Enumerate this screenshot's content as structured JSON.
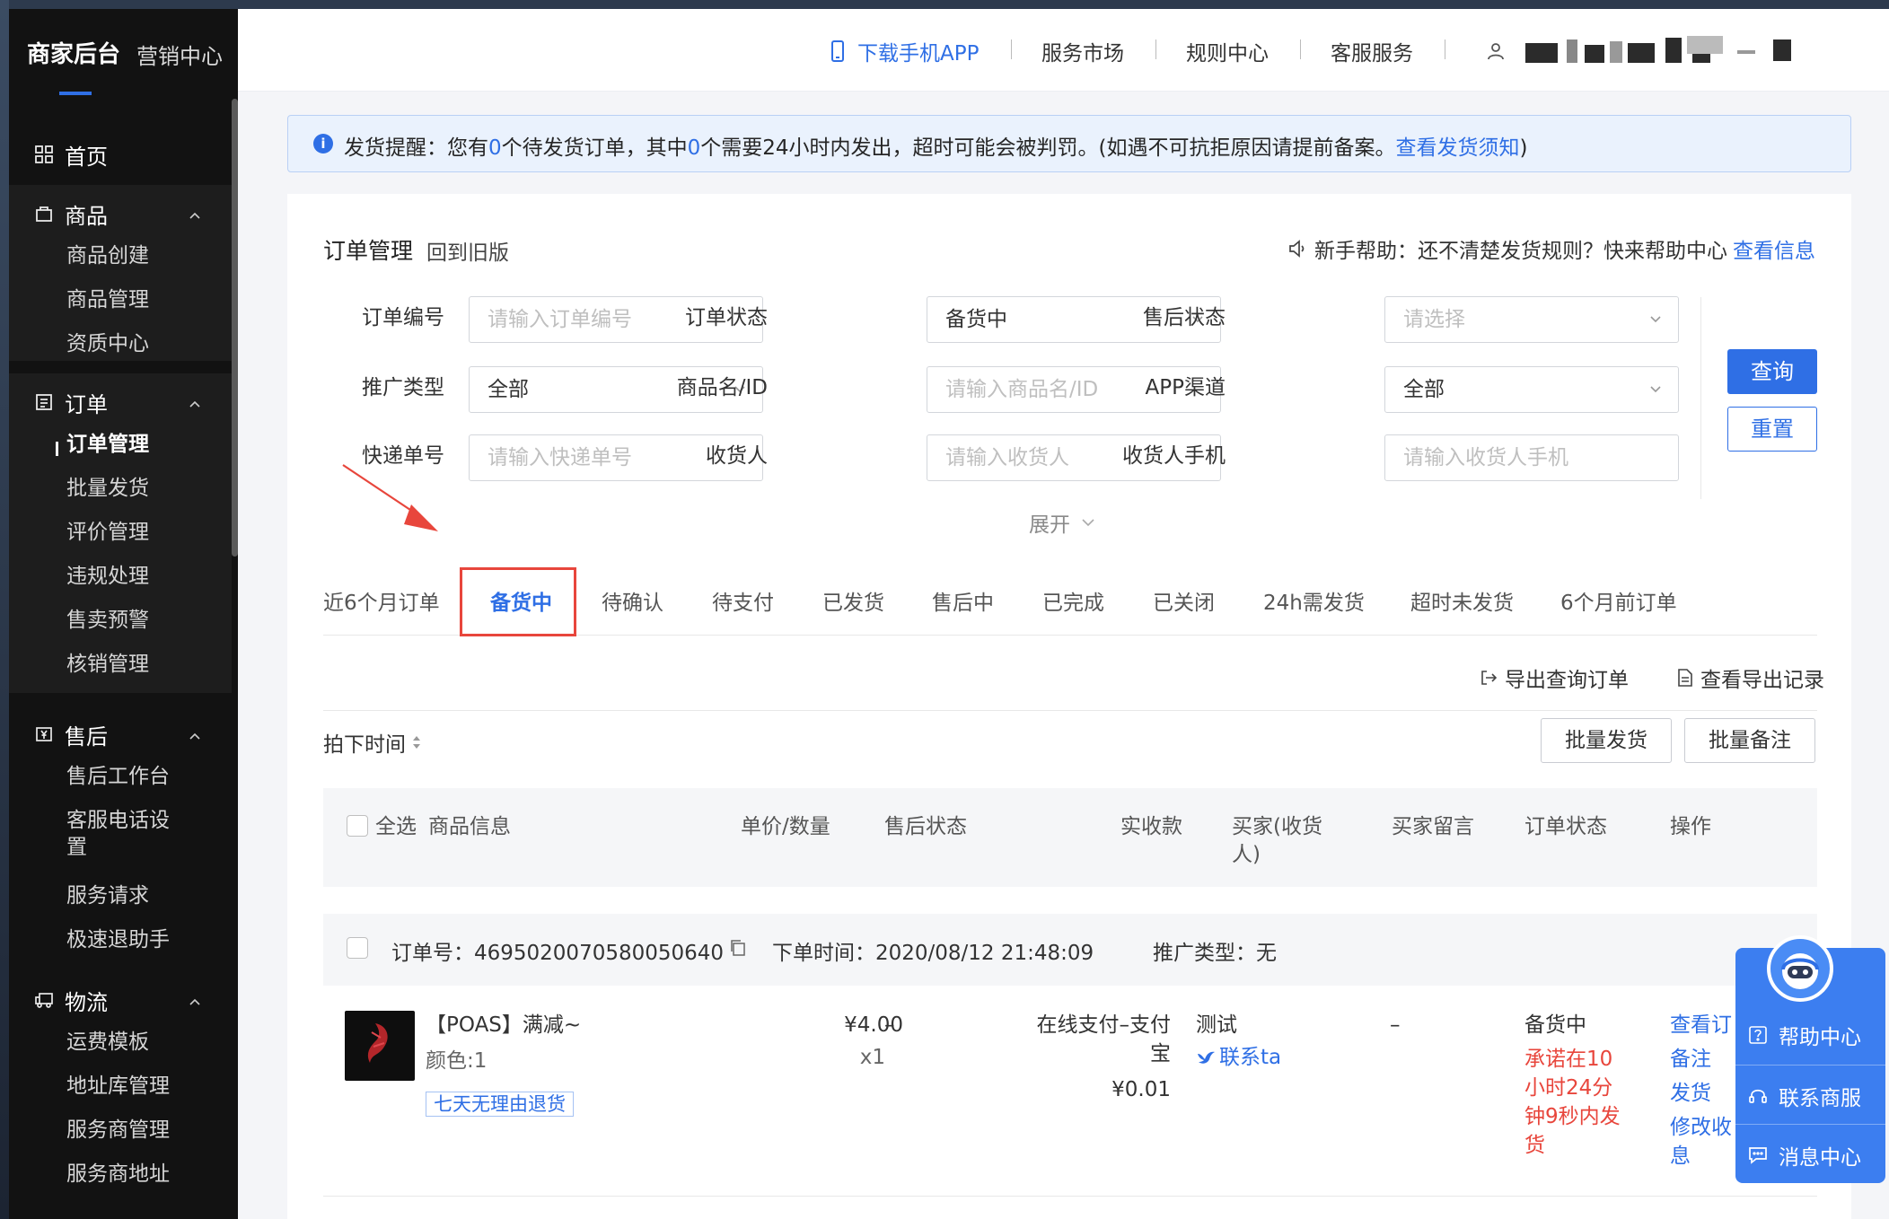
{
  "sidebar": {
    "brand": "商家后台",
    "brand_sub": "营销中心",
    "home": "首页",
    "goods": {
      "label": "商品",
      "items": [
        "商品创建",
        "商品管理",
        "资质中心"
      ]
    },
    "orders": {
      "label": "订单",
      "items": [
        "订单管理",
        "批量发货",
        "评价管理",
        "违规处理",
        "售卖预警",
        "核销管理"
      ]
    },
    "after_sale": {
      "label": "售后",
      "items": [
        "售后工作台",
        "客服电话设",
        "置",
        "服务请求",
        "极速退助手"
      ]
    },
    "logistics": {
      "label": "物流",
      "items": [
        "运费模板",
        "地址库管理",
        "服务商管理",
        "服务商地址"
      ]
    }
  },
  "topbar": {
    "download_app": "下载手机APP",
    "service_market": "服务市场",
    "rules_center": "规则中心",
    "customer_service": "客服服务"
  },
  "notice": {
    "p1": "发货提醒：您有",
    "n1": "0",
    "p2": "个待发货订单，其中",
    "n2": "0",
    "p3": "个需要24小时内发出，超时可能会被判罚。(如遇不可抗拒原因请提前备案。",
    "link": "查看发货须知",
    "p4": ")"
  },
  "card": {
    "title": "订单管理",
    "old_version": "回到旧版",
    "help_text": "新手帮助：还不清楚发货规则？快来帮助中心",
    "help_link": "查看信息"
  },
  "filters": {
    "order_no": {
      "label": "订单编号",
      "placeholder": "请输入订单编号"
    },
    "order_status": {
      "label": "订单状态",
      "value": "备货中"
    },
    "after_status": {
      "label": "售后状态",
      "placeholder": "请选择"
    },
    "promo_type": {
      "label": "推广类型",
      "value": "全部"
    },
    "goods": {
      "label": "商品名/ID",
      "placeholder": "请输入商品名/ID"
    },
    "app_channel": {
      "label": "APP渠道",
      "value": "全部"
    },
    "express_no": {
      "label": "快递单号",
      "placeholder": "请输入快递单号"
    },
    "receiver": {
      "label": "收货人",
      "placeholder": "请输入收货人"
    },
    "receiver_phone": {
      "label": "收货人手机",
      "placeholder": "请输入收货人手机"
    },
    "query": "查询",
    "reset": "重置",
    "expand": "展开"
  },
  "tabs": [
    "近6个月订单",
    "备货中",
    "待确认",
    "待支付",
    "已发货",
    "售后中",
    "已完成",
    "已关闭",
    "24h需发货",
    "超时未发货",
    "6个月前订单"
  ],
  "toolbar": {
    "export": "导出查询订单",
    "export_log": "查看导出记录",
    "sort": "拍下时间",
    "batch_ship": "批量发货",
    "batch_note": "批量备注"
  },
  "table_header": {
    "select_all": "全选",
    "goods_info": "商品信息",
    "price_qty": "单价/数量",
    "after_status": "售后状态",
    "paid": "实收款",
    "buyer_1": "买家(收货",
    "buyer_2": "人)",
    "buyer_msg": "买家留言",
    "order_status": "订单状态",
    "action": "操作"
  },
  "order": {
    "no": "订单号：4695020070580050640",
    "time": "下单时间：2020/08/12 21:48:09",
    "promo": "推广类型：无",
    "title": "【POAS】满减~",
    "spec": "颜色:1",
    "tag": "七天无理由退货",
    "price": "¥4.00",
    "qty": "x1",
    "after": "–",
    "pay_1": "在线支付–支付",
    "pay_2": "宝",
    "paid": "¥0.01",
    "buyer": "测试",
    "contact": "联系ta",
    "msg": "–",
    "status": "备货中",
    "promise": [
      "承诺在10",
      "小时24分",
      "钟9秒内发",
      "货"
    ],
    "actions": [
      "查看订",
      "备注",
      "发货",
      "修改收",
      "息"
    ]
  },
  "float_panel": {
    "help": "帮助中心",
    "contact": "联系商服",
    "msg": "消息中心"
  },
  "colors": {
    "primary": "#2f6fe5",
    "alert": "#e8463c",
    "sidebar": "#121212"
  }
}
